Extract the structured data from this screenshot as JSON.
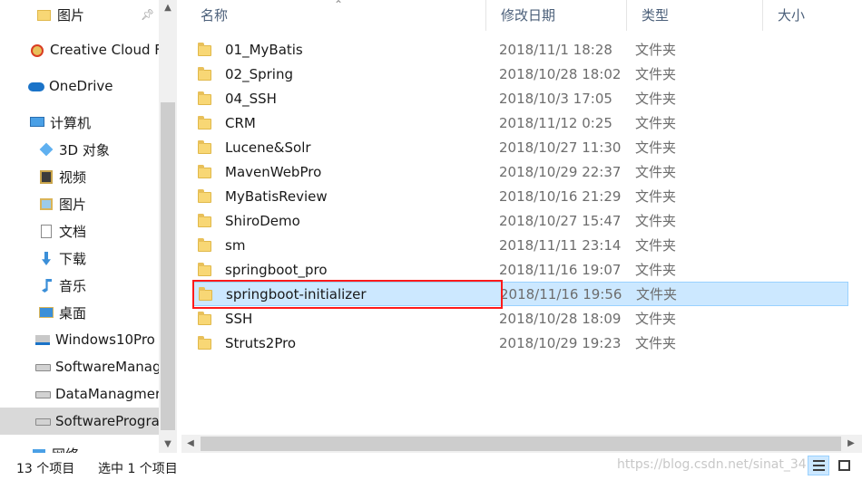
{
  "nav": {
    "items": [
      {
        "label": "图片",
        "icon": "folder-pictures-icon",
        "pinned": true
      },
      {
        "label": "Creative Cloud F",
        "icon": "creative-cloud-icon"
      },
      {
        "label": "OneDrive",
        "icon": "onedrive-cloud-icon"
      },
      {
        "label": "计算机",
        "icon": "computer-icon"
      },
      {
        "label": "3D 对象",
        "icon": "3d-objects-icon"
      },
      {
        "label": "视频",
        "icon": "videos-icon"
      },
      {
        "label": "图片",
        "icon": "pictures-icon"
      },
      {
        "label": "文档",
        "icon": "documents-icon"
      },
      {
        "label": "下载",
        "icon": "downloads-icon"
      },
      {
        "label": "音乐",
        "icon": "music-icon"
      },
      {
        "label": "桌面",
        "icon": "desktop-icon"
      },
      {
        "label": "Windows10Pro",
        "icon": "windows-drive-icon"
      },
      {
        "label": "SoftwareManag",
        "icon": "drive-icon"
      },
      {
        "label": "DataManagmer",
        "icon": "drive-icon"
      },
      {
        "label": "SoftwareProgra",
        "icon": "drive-icon",
        "selected": true
      },
      {
        "label": "网络",
        "icon": "network-icon"
      }
    ]
  },
  "header": {
    "name": "名称",
    "modified": "修改日期",
    "type": "类型",
    "size": "大小"
  },
  "files": [
    {
      "name": "01_MyBatis",
      "date": "2018/11/1 18:28",
      "type": "文件夹"
    },
    {
      "name": "02_Spring",
      "date": "2018/10/28 18:02",
      "type": "文件夹"
    },
    {
      "name": "04_SSH",
      "date": "2018/10/3 17:05",
      "type": "文件夹"
    },
    {
      "name": "CRM",
      "date": "2018/11/12 0:25",
      "type": "文件夹"
    },
    {
      "name": "Lucene&Solr",
      "date": "2018/10/27 11:30",
      "type": "文件夹"
    },
    {
      "name": "MavenWebPro",
      "date": "2018/10/29 22:37",
      "type": "文件夹"
    },
    {
      "name": "MyBatisReview",
      "date": "2018/10/16 21:29",
      "type": "文件夹"
    },
    {
      "name": "ShiroDemo",
      "date": "2018/10/27 15:47",
      "type": "文件夹"
    },
    {
      "name": "sm",
      "date": "2018/11/11 23:14",
      "type": "文件夹"
    },
    {
      "name": "springboot_pro",
      "date": "2018/11/16 19:07",
      "type": "文件夹"
    },
    {
      "name": "springboot-initializer",
      "date": "2018/11/16 19:56",
      "type": "文件夹",
      "selected": true
    },
    {
      "name": "SSH",
      "date": "2018/10/28 18:09",
      "type": "文件夹"
    },
    {
      "name": "Struts2Pro",
      "date": "2018/10/29 19:23",
      "type": "文件夹"
    }
  ],
  "status": {
    "count": "13 个项目",
    "selection": "选中 1 个项目",
    "watermark": "https://blog.csdn.net/sinat_34"
  },
  "colors": {
    "selection_bg": "#cce8ff",
    "highlight_border": "#ff1a1a",
    "header_text": "#4c607a"
  }
}
